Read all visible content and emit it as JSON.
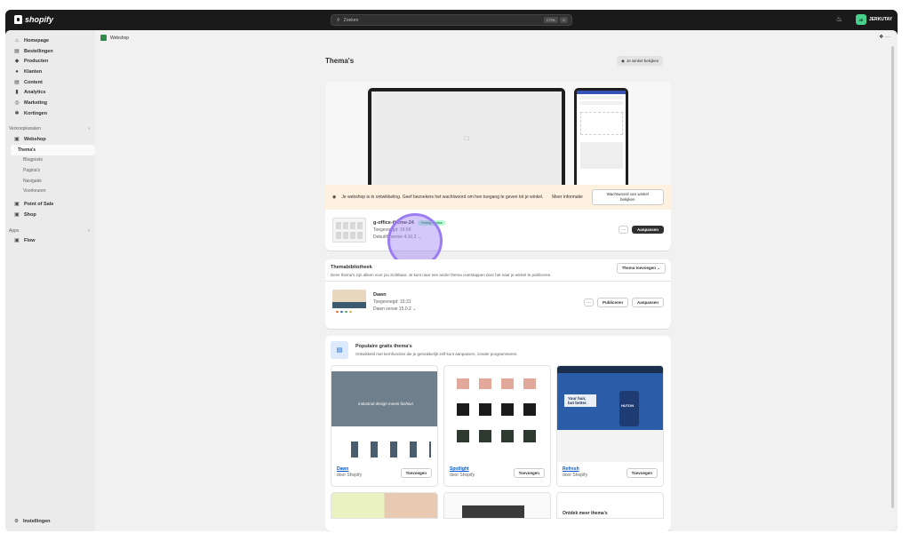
{
  "topbar": {
    "brand": "shopify",
    "search_placeholder": "Zoeken",
    "kbd1": "CTRL",
    "kbd2": "K",
    "store_initials": "JE",
    "store_name": "JERKUTAY"
  },
  "sidebar": {
    "items": [
      {
        "label": "Homepage",
        "icon": "home-icon"
      },
      {
        "label": "Bestellingen",
        "icon": "orders-icon"
      },
      {
        "label": "Producten",
        "icon": "tag-icon"
      },
      {
        "label": "Klanten",
        "icon": "person-icon"
      },
      {
        "label": "Content",
        "icon": "content-icon"
      },
      {
        "label": "Analytics",
        "icon": "chart-icon"
      },
      {
        "label": "Marketing",
        "icon": "target-icon"
      },
      {
        "label": "Kortingen",
        "icon": "discount-icon"
      }
    ],
    "channels_label": "Verkoopkanalen",
    "webshop_label": "Webshop",
    "sub_items": [
      "Thema's",
      "Blogposts",
      "Pagina's",
      "Navigatie",
      "Voorkeuren"
    ],
    "pos_label": "Point of Sale",
    "shop_label": "Shop",
    "apps_label": "Apps",
    "flow_label": "Flow",
    "settings_label": "Instellingen"
  },
  "main": {
    "breadcrumb": "Webshop",
    "title": "Thema's",
    "view_store": "Je winkel bekijken",
    "banner": {
      "text": "Je webshop is in ontwikkeling. Geef bezoekers het wachtwoord om hen toegang te geven tot je winkel.",
      "more": "Meer informatie",
      "button": "Wachtwoord van winkel bekijken"
    },
    "current": {
      "name": "g-office-theme-24",
      "badge": "Huidig thema",
      "added": "Toegevoegd: 15:59",
      "version": "Debutify versie 4.10.2"
    },
    "customize": "Aanpassen",
    "library": {
      "title": "Themabibliotheek",
      "subtitle": "Deze thema's zijn alleen voor jou zichtbaar. Je kunt naar een ander thema overstappen door het naar je winkel te publiceren.",
      "add": "Thema toevoegen",
      "dawn_name": "Dawn",
      "dawn_added": "Toegevoegd: 15:31",
      "dawn_version": "Dawn versie 15.0.2",
      "publish": "Publiceren",
      "customize": "Aanpassen"
    },
    "popular": {
      "title": "Populaire gratis thema's",
      "subtitle": "Ontwikkeld met kernfuncties die je gemakkelijk zelf kunt aanpassen, zonder programmeren.",
      "themes": [
        {
          "name": "Dawn",
          "by": "door Shopify",
          "add": "Toevoegen",
          "hero": "Industrial design meets fashion"
        },
        {
          "name": "Spotlight",
          "by": "door Shopify",
          "add": "Toevoegen",
          "hero": ""
        },
        {
          "name": "Refresh",
          "by": "door Shopify",
          "add": "Toevoegen",
          "hero": "Your hair, but better."
        }
      ],
      "discover": "Ontdek meer thema's"
    }
  }
}
